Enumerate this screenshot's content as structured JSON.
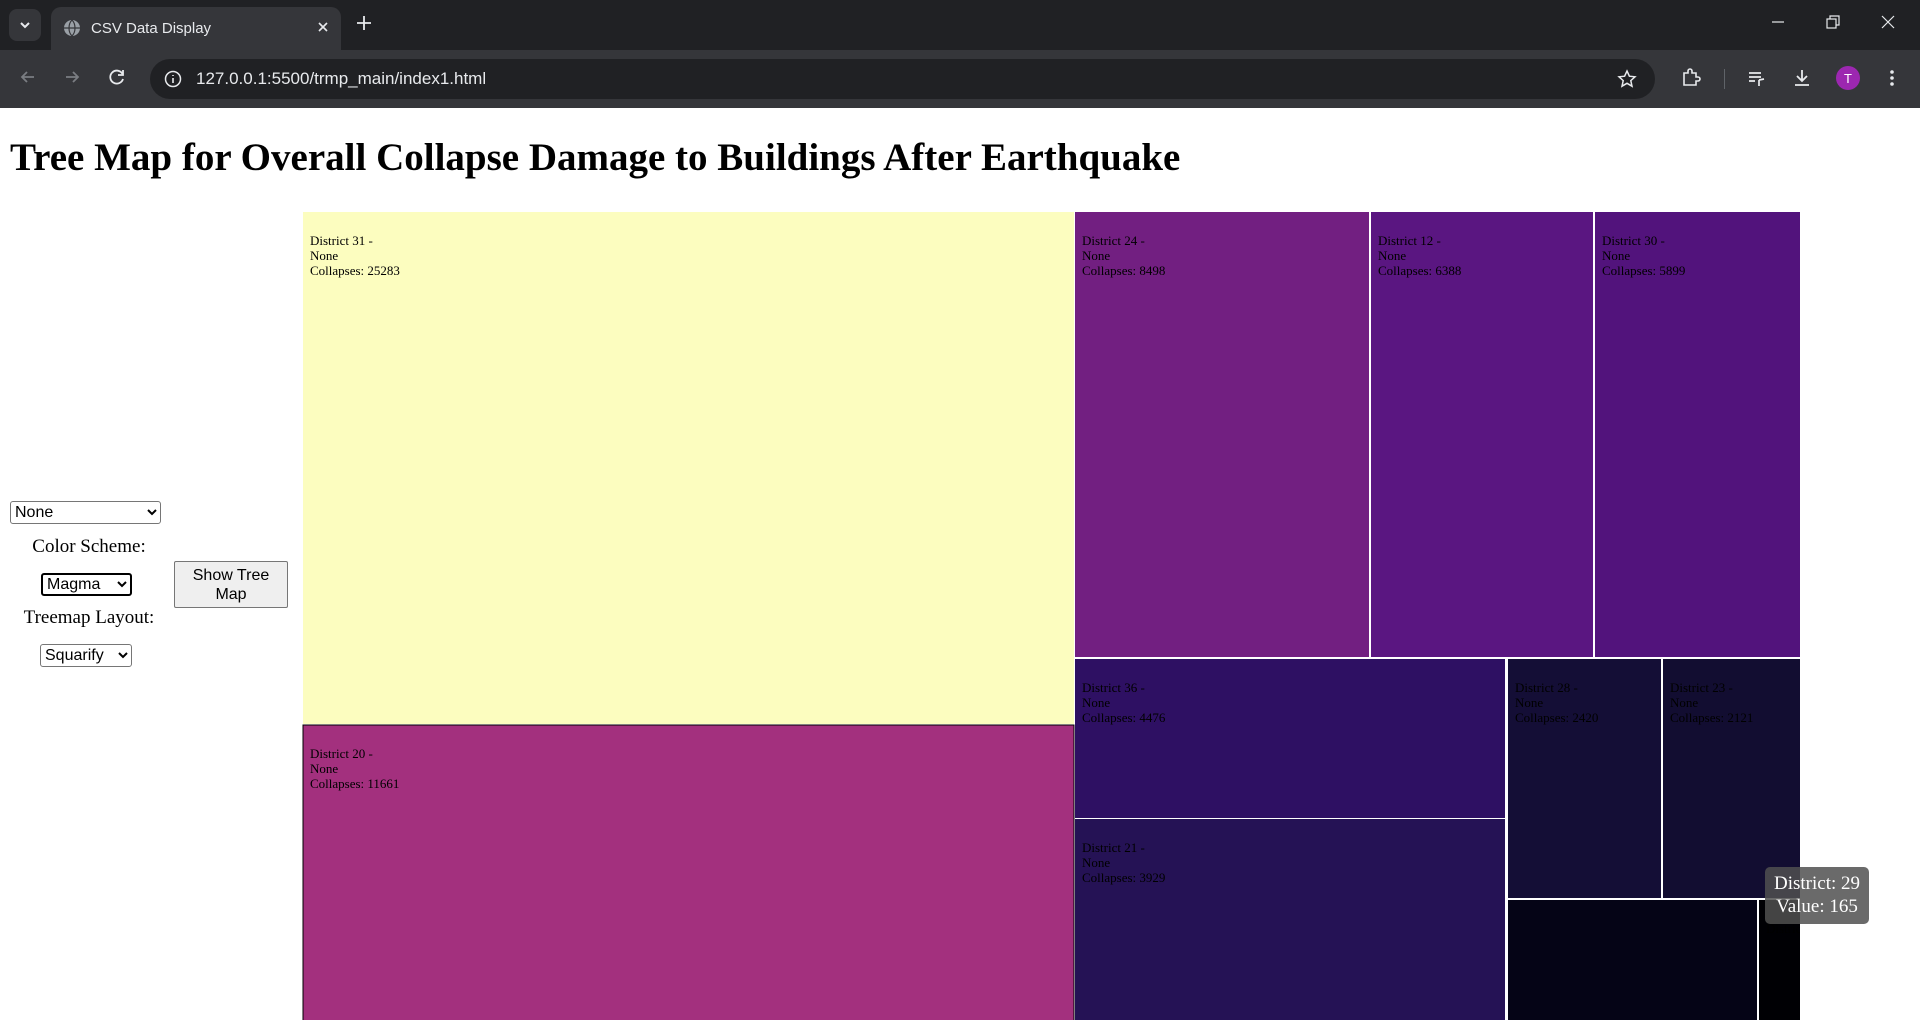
{
  "browser": {
    "tab_title": "CSV Data Display",
    "url": "127.0.0.1:5500/trmp_main/index1.html",
    "avatar_letter": "T"
  },
  "page": {
    "title": "Tree Map for Overall Collapse Damage to Buildings After Earthquake"
  },
  "controls": {
    "district_filter_value": "None",
    "color_scheme_label": "Color Scheme:",
    "color_scheme_value": "Magma",
    "layout_label": "Treemap Layout:",
    "layout_value": "Squarify",
    "show_button_label": "Show Tree Map"
  },
  "tooltip": {
    "district_line": "District: 29",
    "value_line": "Value: 165"
  },
  "chart_data": {
    "type": "treemap",
    "title": "Tree Map for Overall Collapse Damage to Buildings After Earthquake",
    "layout": "squarify",
    "color_scheme": "magma",
    "nodes": [
      {
        "district": "District 31 -",
        "group": "None",
        "collapses": 25283,
        "label": "Collapses: 25283",
        "color": "#fcfdbf"
      },
      {
        "district": "District 20 -",
        "group": "None",
        "collapses": 11661,
        "label": "Collapses: 11661",
        "color": "#a3307e"
      },
      {
        "district": "District 24 -",
        "group": "None",
        "collapses": 8498,
        "label": "Collapses: 8498",
        "color": "#721f81"
      },
      {
        "district": "District 12 -",
        "group": "None",
        "collapses": 6388,
        "label": "Collapses: 6388",
        "color": "#5a1681"
      },
      {
        "district": "District 30 -",
        "group": "None",
        "collapses": 5899,
        "label": "Collapses: 5899",
        "color": "#52137c"
      },
      {
        "district": "District 36 -",
        "group": "None",
        "collapses": 4476,
        "label": "Collapses: 4476",
        "color": "#2e1063"
      },
      {
        "district": "District 21 -",
        "group": "None",
        "collapses": 3929,
        "label": "Collapses: 3929",
        "color": "#251255"
      },
      {
        "district": "District 28 -",
        "group": "None",
        "collapses": 2420,
        "label": "Collapses: 2420",
        "color": "#140e36"
      },
      {
        "district": "District 23 -",
        "group": "None",
        "collapses": 2121,
        "label": "Collapses: 2121",
        "color": "#120d31"
      },
      {
        "district": "",
        "group": "",
        "collapses": 0,
        "label": "",
        "color": "#050416"
      },
      {
        "district": "District 29",
        "group": "",
        "collapses": 165,
        "label": "",
        "color": "#000004"
      }
    ]
  }
}
